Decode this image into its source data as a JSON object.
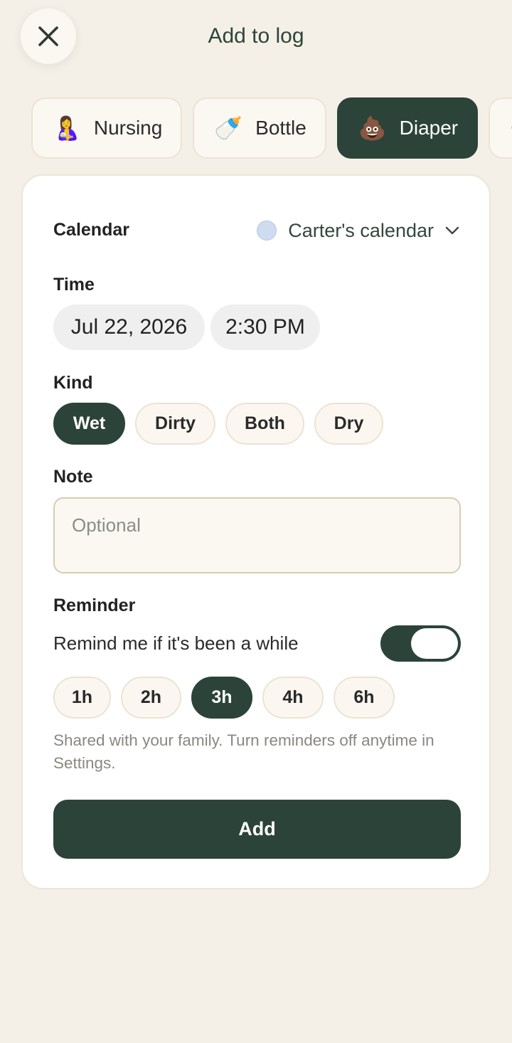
{
  "header": {
    "title": "Add to log",
    "close_icon": "close-icon"
  },
  "log_types": [
    {
      "label": "Nursing",
      "emoji": "🤱",
      "icon": "nursing-icon",
      "active": false
    },
    {
      "label": "Bottle",
      "emoji": "🍼",
      "icon": "bottle-icon",
      "active": false
    },
    {
      "label": "Diaper",
      "emoji": "💩",
      "icon": "diaper-icon",
      "active": true
    },
    {
      "label": "",
      "emoji": "😴",
      "icon": "sleep-icon",
      "active": false
    }
  ],
  "form": {
    "calendar_label": "Calendar",
    "calendar_value": "Carter's calendar",
    "calendar_color": "#cfdbef",
    "time_label": "Time",
    "date_value": "Jul 22, 2026",
    "time_value": "2:30 PM",
    "kind_label": "Kind",
    "kinds": [
      "Wet",
      "Dirty",
      "Both",
      "Dry"
    ],
    "kind_selected": "Wet",
    "note_label": "Note",
    "note_placeholder": "Optional",
    "note_value": "",
    "reminder_label": "Reminder",
    "reminder_text": "Remind me if it's been a while",
    "reminder_enabled": true,
    "intervals": [
      "1h",
      "2h",
      "3h",
      "4h",
      "6h"
    ],
    "interval_selected": "3h",
    "helper_text": "Shared with your family. Turn reminders off anytime in Settings.",
    "submit_label": "Add"
  },
  "colors": {
    "accent": "#2c4339",
    "background": "#f4f0e8",
    "card": "#ffffff"
  }
}
